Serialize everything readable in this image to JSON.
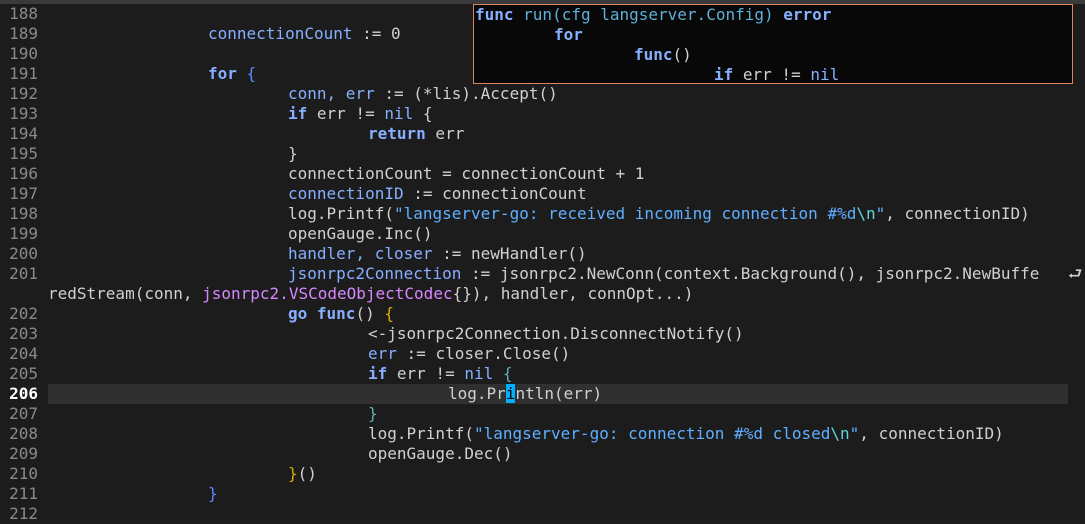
{
  "editor": {
    "lines": [
      {
        "num": "188"
      },
      {
        "num": "189"
      },
      {
        "num": "190"
      },
      {
        "num": "191"
      },
      {
        "num": "192"
      },
      {
        "num": "193"
      },
      {
        "num": "194"
      },
      {
        "num": "195"
      },
      {
        "num": "196"
      },
      {
        "num": "197"
      },
      {
        "num": "198"
      },
      {
        "num": "199"
      },
      {
        "num": "200"
      },
      {
        "num": "201"
      },
      {
        "num": ""
      },
      {
        "num": "202"
      },
      {
        "num": "203"
      },
      {
        "num": "204"
      },
      {
        "num": "205"
      },
      {
        "num": "206"
      },
      {
        "num": "207"
      },
      {
        "num": "208"
      },
      {
        "num": "209"
      },
      {
        "num": "210"
      },
      {
        "num": "211"
      },
      {
        "num": "212"
      }
    ]
  },
  "code": {
    "l189": [
      "connectionCount",
      " := 0"
    ],
    "l191": [
      "for",
      "{"
    ],
    "l192": [
      "conn, err",
      " := (*lis).Accept()"
    ],
    "l193": [
      "if",
      " err != ",
      "nil",
      " {"
    ],
    "l194": [
      "return",
      " err"
    ],
    "l195": [
      "}"
    ],
    "l196": [
      "connectionCount = connectionCount + 1"
    ],
    "l197": [
      "connectionID",
      " := connectionCount"
    ],
    "l198": [
      "log.Printf(",
      "\"langserver-go: received incoming connection #%d",
      "\\n",
      "\"",
      ", connectionID)"
    ],
    "l199": [
      "openGauge.Inc()"
    ],
    "l200": [
      "handler, closer",
      " := newHandler()"
    ],
    "l201": [
      "jsonrpc2Connection",
      " := jsonrpc2.NewConn(context.Background(), jsonrpc2.NewBuffe",
      "⮐"
    ],
    "l201b": [
      "redStream(conn, ",
      "jsonrpc2.VSCodeObjectCodec",
      "{}), handler, connOpt...)"
    ],
    "l202": [
      "go",
      "func",
      "() ",
      "{"
    ],
    "l203": [
      "<-jsonrpc2Connection.DisconnectNotify()"
    ],
    "l204": [
      "err",
      " := closer.Close()"
    ],
    "l205": [
      "if",
      " err != ",
      "nil",
      "{"
    ],
    "l206": [
      "log.Pr",
      "i",
      "ntln(err)"
    ],
    "l207": [
      "}"
    ],
    "l208": [
      "log.Printf(",
      "\"langserver-go: connection #%d closed",
      "\\n",
      "\"",
      ", connectionID)"
    ],
    "l209": [
      "openGauge.Dec()"
    ],
    "l210": [
      "}",
      "()"
    ],
    "l211": [
      "}"
    ]
  },
  "popup": {
    "line1": [
      "func",
      " run(cfg langserver.Config) ",
      "error"
    ],
    "line2": [
      "for"
    ],
    "line3": [
      "func",
      "()"
    ],
    "line4": [
      "if",
      " err != ",
      "nil"
    ]
  }
}
